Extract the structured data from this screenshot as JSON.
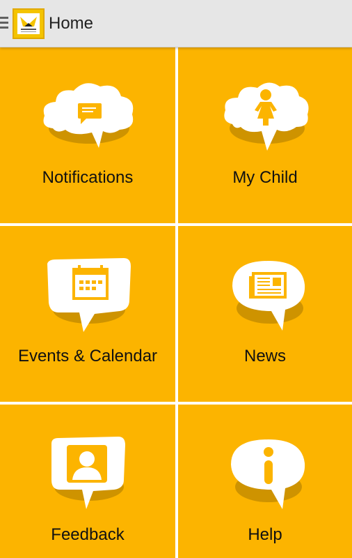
{
  "header": {
    "title": "Home",
    "menu_icon": "hamburger-menu-icon",
    "logo_icon": "school-logo"
  },
  "colors": {
    "tile_background": "#fcb400",
    "header_background": "#e6e6e6",
    "bubble": "#ffffff",
    "icon": "#fcb400"
  },
  "tiles": [
    {
      "label": "Notifications",
      "icon": "chat-bubble-icon"
    },
    {
      "label": "My Child",
      "icon": "child-icon"
    },
    {
      "label": "Events & Calendar",
      "icon": "calendar-icon"
    },
    {
      "label": "News",
      "icon": "newspaper-icon"
    },
    {
      "label": "Feedback",
      "icon": "user-icon"
    },
    {
      "label": "Help",
      "icon": "info-icon"
    }
  ]
}
